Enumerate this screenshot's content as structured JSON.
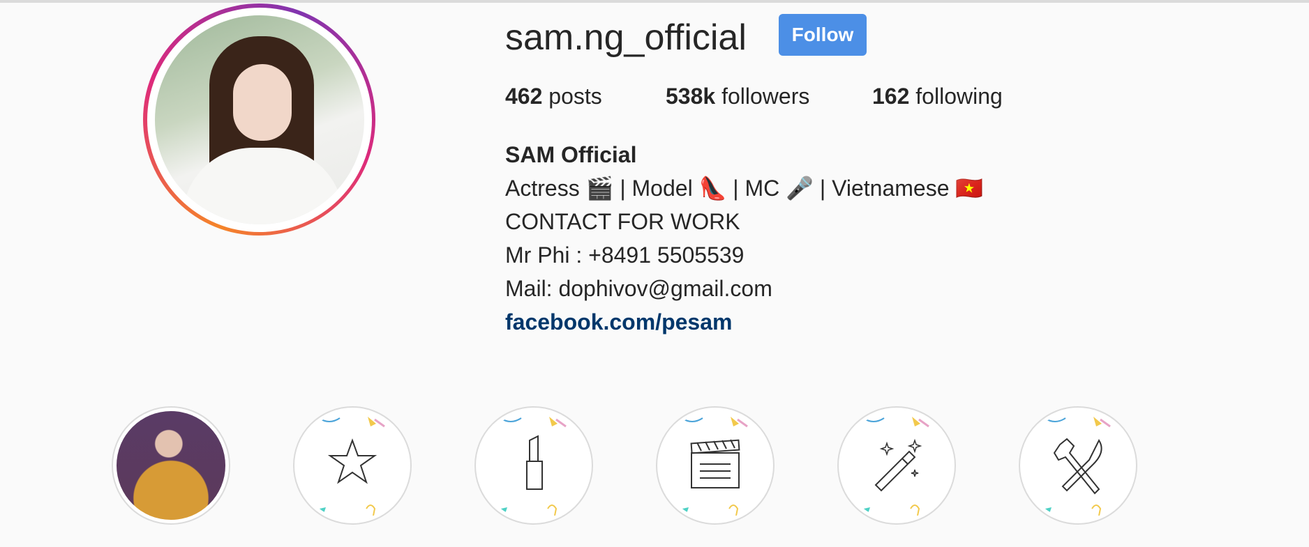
{
  "profile": {
    "username": "sam.ng_official",
    "follow_label": "Follow",
    "stats": {
      "posts_count": "462",
      "posts_label": "posts",
      "followers_count": "538k",
      "followers_label": "followers",
      "following_count": "162",
      "following_label": "following"
    },
    "bio": {
      "name": "SAM Official",
      "line1": "Actress 🎬  | Model 👠  | MC 🎤 | Vietnamese 🇻🇳",
      "line2": "CONTACT FOR WORK",
      "line3": "Mr Phi : +8491 5505539",
      "line4": "Mail: dophivov@gmail.com",
      "link": "facebook.com/pesam"
    }
  },
  "highlights": [
    {
      "icon": "photo",
      "label": ""
    },
    {
      "icon": "star-icon",
      "label": ""
    },
    {
      "icon": "lipstick-icon",
      "label": ""
    },
    {
      "icon": "clapperboard-icon",
      "label": ""
    },
    {
      "icon": "magic-wand-icon",
      "label": ""
    },
    {
      "icon": "fork-knife-icon",
      "label": ""
    }
  ],
  "colors": {
    "follow_button": "#4c8fe6",
    "link": "#00376b",
    "background": "#fafafa"
  }
}
